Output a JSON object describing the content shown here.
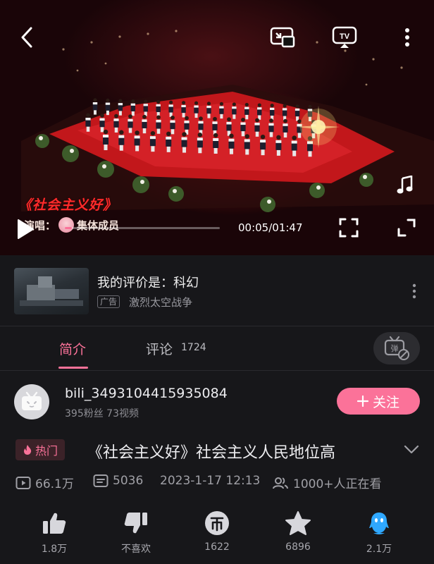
{
  "player": {
    "song_title": "《社会主义好》",
    "singer_prefix": "演唱：",
    "singer_name": "集体成员",
    "current_time": "00:05",
    "duration": "01:47",
    "time_display": "00:05/01:47",
    "progress": 0.047
  },
  "ad": {
    "title": "我的评价是：科幻",
    "tag": "广告",
    "subtitle": "激烈太空战争"
  },
  "tabs": [
    {
      "label": "简介",
      "active": true
    },
    {
      "label": "评论",
      "count": "1724",
      "active": false
    }
  ],
  "uploader": {
    "name": "bili_3493104415935084",
    "stats": "395粉丝  73视频",
    "follow_label": "关注"
  },
  "video": {
    "hot_label": "热门",
    "title": "《社会主义好》社会主义人民地位高"
  },
  "stats": {
    "views": "66.1万",
    "danmaku": "5036",
    "date": "2023-1-17 12:13",
    "watching": "1000+人正在看"
  },
  "actions": [
    {
      "icon": "like-icon",
      "label": "1.8万"
    },
    {
      "icon": "dislike-icon",
      "label": "不喜欢"
    },
    {
      "icon": "coin-icon",
      "label": "1622"
    },
    {
      "icon": "star-icon",
      "label": "6896"
    },
    {
      "icon": "share-icon",
      "label": "2.1万"
    }
  ],
  "colors": {
    "accent": "#fb7299",
    "background": "#17171a",
    "song_title": "#ff2b2b",
    "share": "#2fa8ff"
  }
}
